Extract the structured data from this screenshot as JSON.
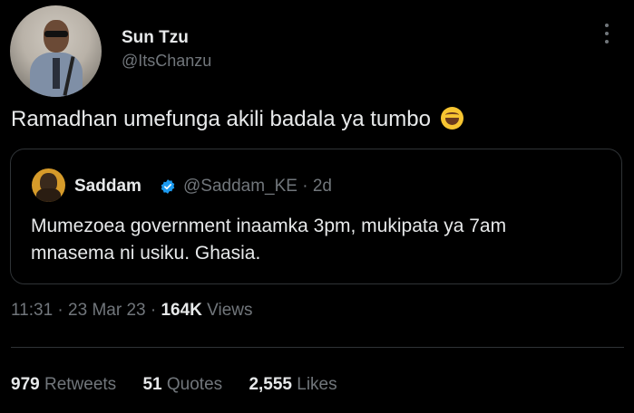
{
  "author": {
    "display_name": "Sun Tzu",
    "handle": "@ItsChanzu"
  },
  "tweet": {
    "text": "Ramadhan umefunga akili badala ya tumbo",
    "emoji": "grinning-sweat-emoji"
  },
  "quoted_tweet": {
    "display_name": "Saddam",
    "handle": "@Saddam_KE",
    "separator": "·",
    "time": "2d",
    "text": "Mumezoea government inaamka 3pm, mukipata ya 7am mnasema ni usiku. Ghasia."
  },
  "meta": {
    "time": "11:31",
    "sep1": "·",
    "date": "23 Mar 23",
    "sep2": "·",
    "views": "164K",
    "views_label": "Views"
  },
  "stats": {
    "retweets": "979",
    "retweets_label": "Retweets",
    "quotes": "51",
    "quotes_label": "Quotes",
    "likes": "2,555",
    "likes_label": "Likes"
  },
  "colors": {
    "background": "#000000",
    "primary_text": "#e7e9ea",
    "secondary_text": "#71767b",
    "border": "#2f3336",
    "verified": "#1d9bf0"
  }
}
